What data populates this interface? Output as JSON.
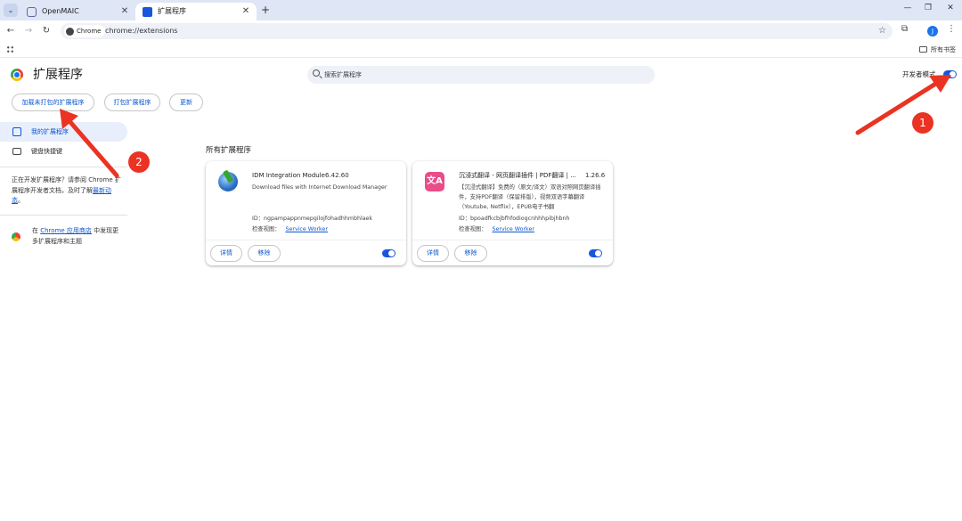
{
  "tabs": [
    {
      "title": "OpenMAIC",
      "active": false
    },
    {
      "title": "扩展程序",
      "active": true
    }
  ],
  "toolbar": {
    "chip_label": "Chrome",
    "url": "chrome://extensions",
    "avatar_letter": "J"
  },
  "bookmarks": {
    "all_label": "所有书签"
  },
  "header": {
    "title": "扩展程序",
    "search_placeholder": "搜索扩展程序",
    "dev_mode_label": "开发者模式",
    "dev_mode_on": true
  },
  "actions": {
    "load_unpacked": "加载未打包的扩展程序",
    "pack": "打包扩展程序",
    "update": "更新"
  },
  "sidebar": {
    "items": [
      {
        "label": "我的扩展程序",
        "selected": true
      },
      {
        "label": "键盘快捷键",
        "selected": false
      }
    ],
    "note_text": "正在开发扩展程序？请参阅 Chrome 扩展程序开发者文档，及时了解",
    "note_link": "最新动态",
    "note_end": "。",
    "store_prefix": "在 ",
    "store_link": "Chrome 应用商店",
    "store_suffix": " 中发现更多扩展程序和主题"
  },
  "main": {
    "section_title": "所有扩展程序",
    "cards": [
      {
        "name": "IDM Integration Module",
        "version": "6.42.60",
        "description": "Download files with Internet Download Manager",
        "id": "ID：ngpampappnmepgilojfohadhhmbhlaek",
        "inspect_label": "检查视图：",
        "inspect_link": "Service Worker",
        "details": "详情",
        "remove": "移除",
        "enabled": true,
        "icon": "idm-icon"
      },
      {
        "name": "沉浸式翻译 - 网页翻译插件 | PDF翻译 | ...",
        "version": "1.26.6",
        "description": "【沉浸式翻译】免费的（原文/译文）双语对照网页翻译插件，支持PDF翻译（保留排版），视频双语字幕翻译（Youtube, Netflix），EPUB电子书翻",
        "id": "ID：bpoadfkcbjbfhfodiogcnhhhpibjhbnh",
        "inspect_label": "检查视图：",
        "inspect_link": "Service Worker",
        "details": "详情",
        "remove": "移除",
        "enabled": true,
        "icon": "immersive-translate-icon",
        "icon_text": "文A"
      }
    ]
  },
  "annotations": [
    {
      "label": "1",
      "color": "#ea3323"
    },
    {
      "label": "2",
      "color": "#ea3323"
    }
  ]
}
